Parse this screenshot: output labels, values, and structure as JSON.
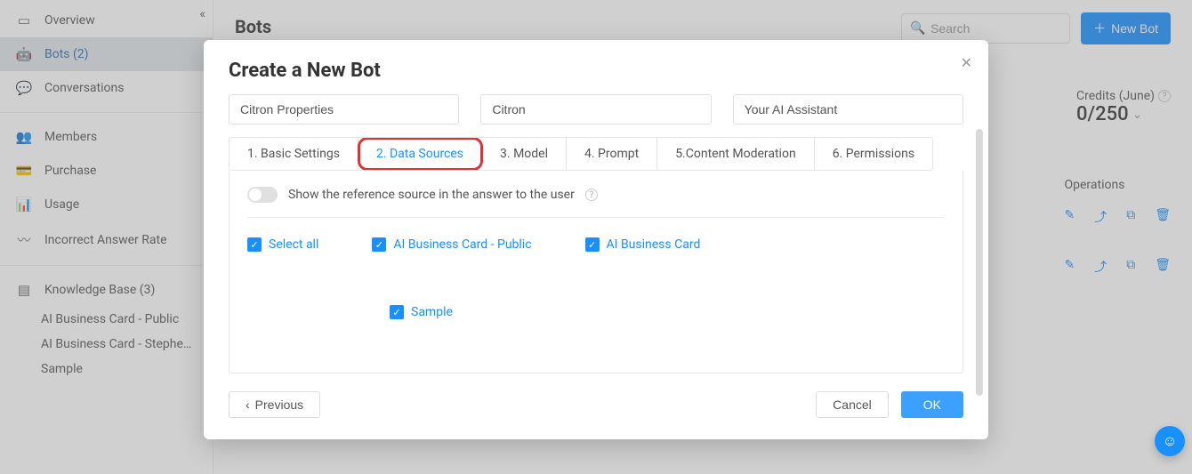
{
  "sidebar": {
    "overview": "Overview",
    "bots": "Bots (2)",
    "conversations": "Conversations",
    "members": "Members",
    "purchase": "Purchase",
    "usage": "Usage",
    "incorrect": "Incorrect Answer Rate",
    "kb": "Knowledge Base (3)",
    "kb_items": [
      "AI Business Card - Public",
      "AI Business Card - Stephen Ng.",
      "Sample"
    ]
  },
  "page": {
    "title": "Bots",
    "search_placeholder": "Search",
    "new_bot": "New Bot",
    "credits_label": "Credits (June)",
    "credits_value": "0/250",
    "operations": "Operations"
  },
  "modal": {
    "title": "Create a New Bot",
    "fields": {
      "company": "Citron Properties",
      "name": "Citron",
      "tagline": "Your AI Assistant"
    },
    "tabs": [
      "1. Basic Settings",
      "2. Data Sources",
      "3. Model",
      "4. Prompt",
      "5.Content Moderation",
      "6. Permissions"
    ],
    "toggle_label": "Show the reference source in the answer to the user",
    "checks": {
      "select_all": "Select all",
      "item1": "AI Business Card - Public",
      "item2": "AI Business Card",
      "item3": "Sample"
    },
    "previous": "Previous",
    "cancel": "Cancel",
    "ok": "OK"
  }
}
